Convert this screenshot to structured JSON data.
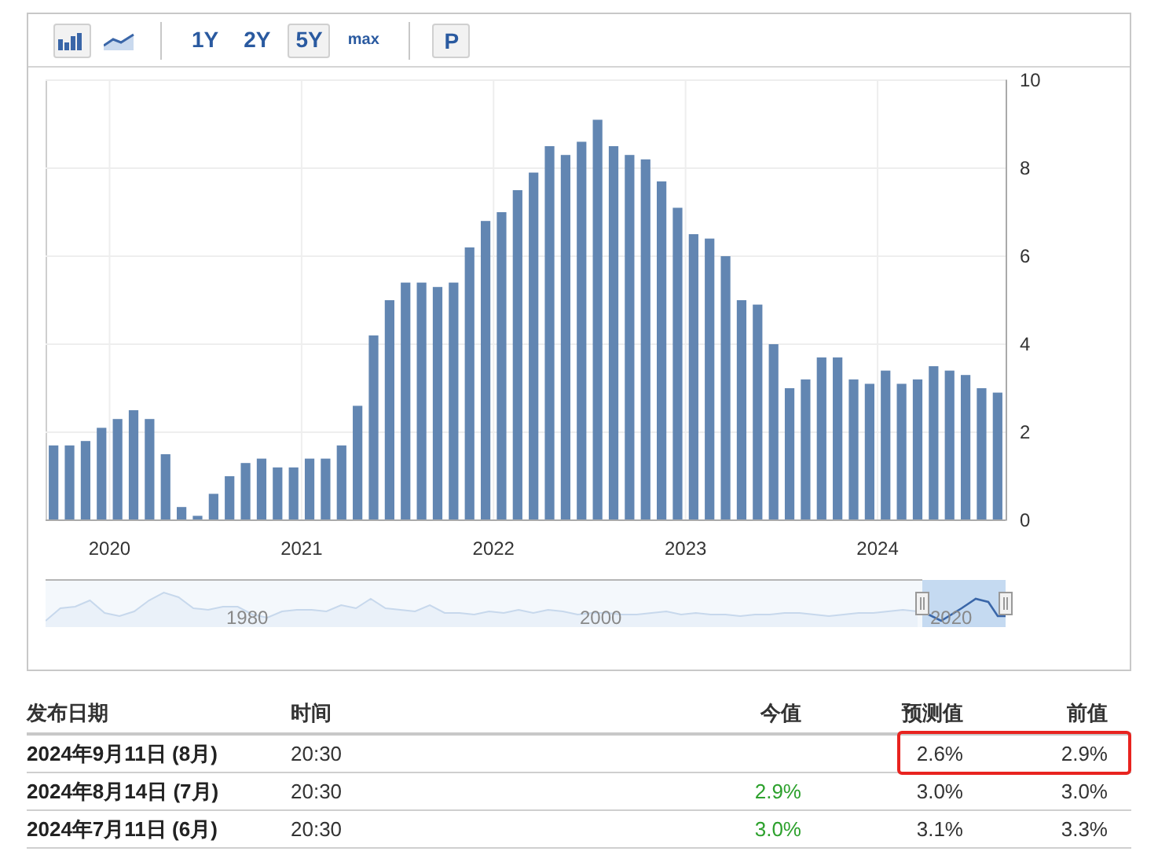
{
  "toolbar": {
    "chart_types": [
      {
        "kind": "bar",
        "selected": true
      },
      {
        "kind": "line",
        "selected": false
      }
    ],
    "ranges": [
      {
        "label": "1Y",
        "selected": false
      },
      {
        "label": "2Y",
        "selected": false
      },
      {
        "label": "5Y",
        "selected": true
      },
      {
        "label": "max",
        "selected": false
      }
    ],
    "print_button": "P"
  },
  "chart_data": {
    "type": "bar",
    "values": [
      1.7,
      1.7,
      1.8,
      2.1,
      2.3,
      2.5,
      2.3,
      1.5,
      0.3,
      0.1,
      0.6,
      1.0,
      1.3,
      1.4,
      1.2,
      1.2,
      1.4,
      1.4,
      1.7,
      2.6,
      4.2,
      5.0,
      5.4,
      5.4,
      5.3,
      5.4,
      6.2,
      6.8,
      7.0,
      7.5,
      7.9,
      8.5,
      8.3,
      8.6,
      9.1,
      8.5,
      8.3,
      8.2,
      7.7,
      7.1,
      6.5,
      6.4,
      6.0,
      5.0,
      4.9,
      4.0,
      3.0,
      3.2,
      3.7,
      3.7,
      3.2,
      3.1,
      3.4,
      3.1,
      3.2,
      3.5,
      3.4,
      3.3,
      3.0,
      2.9
    ],
    "ylim": [
      0,
      10
    ],
    "yticks": [
      0,
      2,
      4,
      6,
      8,
      10
    ],
    "grid": true
  },
  "x_axis": {
    "labels": [
      "2020",
      "2021",
      "2022",
      "2023",
      "2024"
    ]
  },
  "navigator": {
    "labels": [
      "1980",
      "2000",
      "2020"
    ]
  },
  "table": {
    "columns": [
      "发布日期",
      "时间",
      "今值",
      "预测值",
      "前值"
    ],
    "rows": [
      {
        "cells": [
          "2024年9月11日 (8月)",
          "20:30",
          "",
          "2.6%",
          "2.9%"
        ],
        "highlighted": true
      },
      {
        "cells": [
          "2024年8月14日 (7月)",
          "20:30",
          "2.9%",
          "3.0%",
          "3.0%"
        ],
        "highlighted": false
      },
      {
        "cells": [
          "2024年7月11日 (6月)",
          "20:30",
          "3.0%",
          "3.1%",
          "3.3%"
        ],
        "highlighted": false
      }
    ]
  }
}
